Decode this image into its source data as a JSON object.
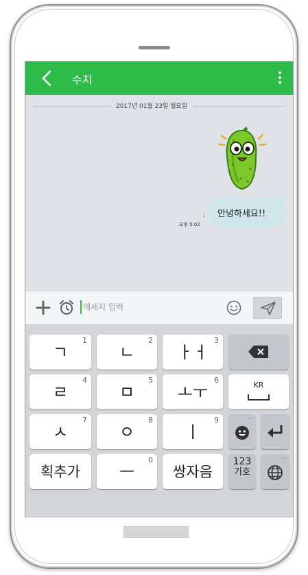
{
  "chat": {
    "title": "수지",
    "date_separator": "2017년 01월 23일 월요일",
    "message": {
      "text": "안녕하세요!!",
      "unread_count": "1",
      "time": "오후 5:02"
    }
  },
  "composer": {
    "placeholder": "메세지 입력"
  },
  "keyboard": {
    "rows": [
      [
        {
          "label": "ㄱ",
          "number": "1"
        },
        {
          "label": "ㄴ",
          "number": "2"
        },
        {
          "label": "ㅏㅓ",
          "number": "3"
        }
      ],
      [
        {
          "label": "ㄹ",
          "number": "4"
        },
        {
          "label": "ㅁ",
          "number": "5"
        },
        {
          "label": "ㅗㅜ",
          "number": "6"
        }
      ],
      [
        {
          "label": "ㅅ",
          "number": "7"
        },
        {
          "label": "ㅇ",
          "number": "8"
        },
        {
          "label": "ㅣ",
          "number": "9"
        }
      ],
      [
        {
          "label": "획추가",
          "number": ""
        },
        {
          "label": "ㅡ",
          "number": "0"
        },
        {
          "label": "쌍자음",
          "number": ""
        }
      ]
    ],
    "language_key": "KR",
    "symbol_key_top": "123",
    "symbol_key_bottom": "기호",
    "more_dots": "..."
  },
  "colors": {
    "accent": "#2dbb49",
    "bubble": "#cfe6ea",
    "chat_bg": "#dfe3e8",
    "keyboard_bg": "#d3d5d8"
  },
  "icons": [
    "back-arrow-icon",
    "more-vertical-icon",
    "plus-icon",
    "alarm-clock-icon",
    "smiley-icon",
    "send-icon",
    "backspace-icon",
    "space-icon",
    "emoji-icon",
    "enter-icon",
    "globe-icon",
    "cucumber-sticker"
  ]
}
